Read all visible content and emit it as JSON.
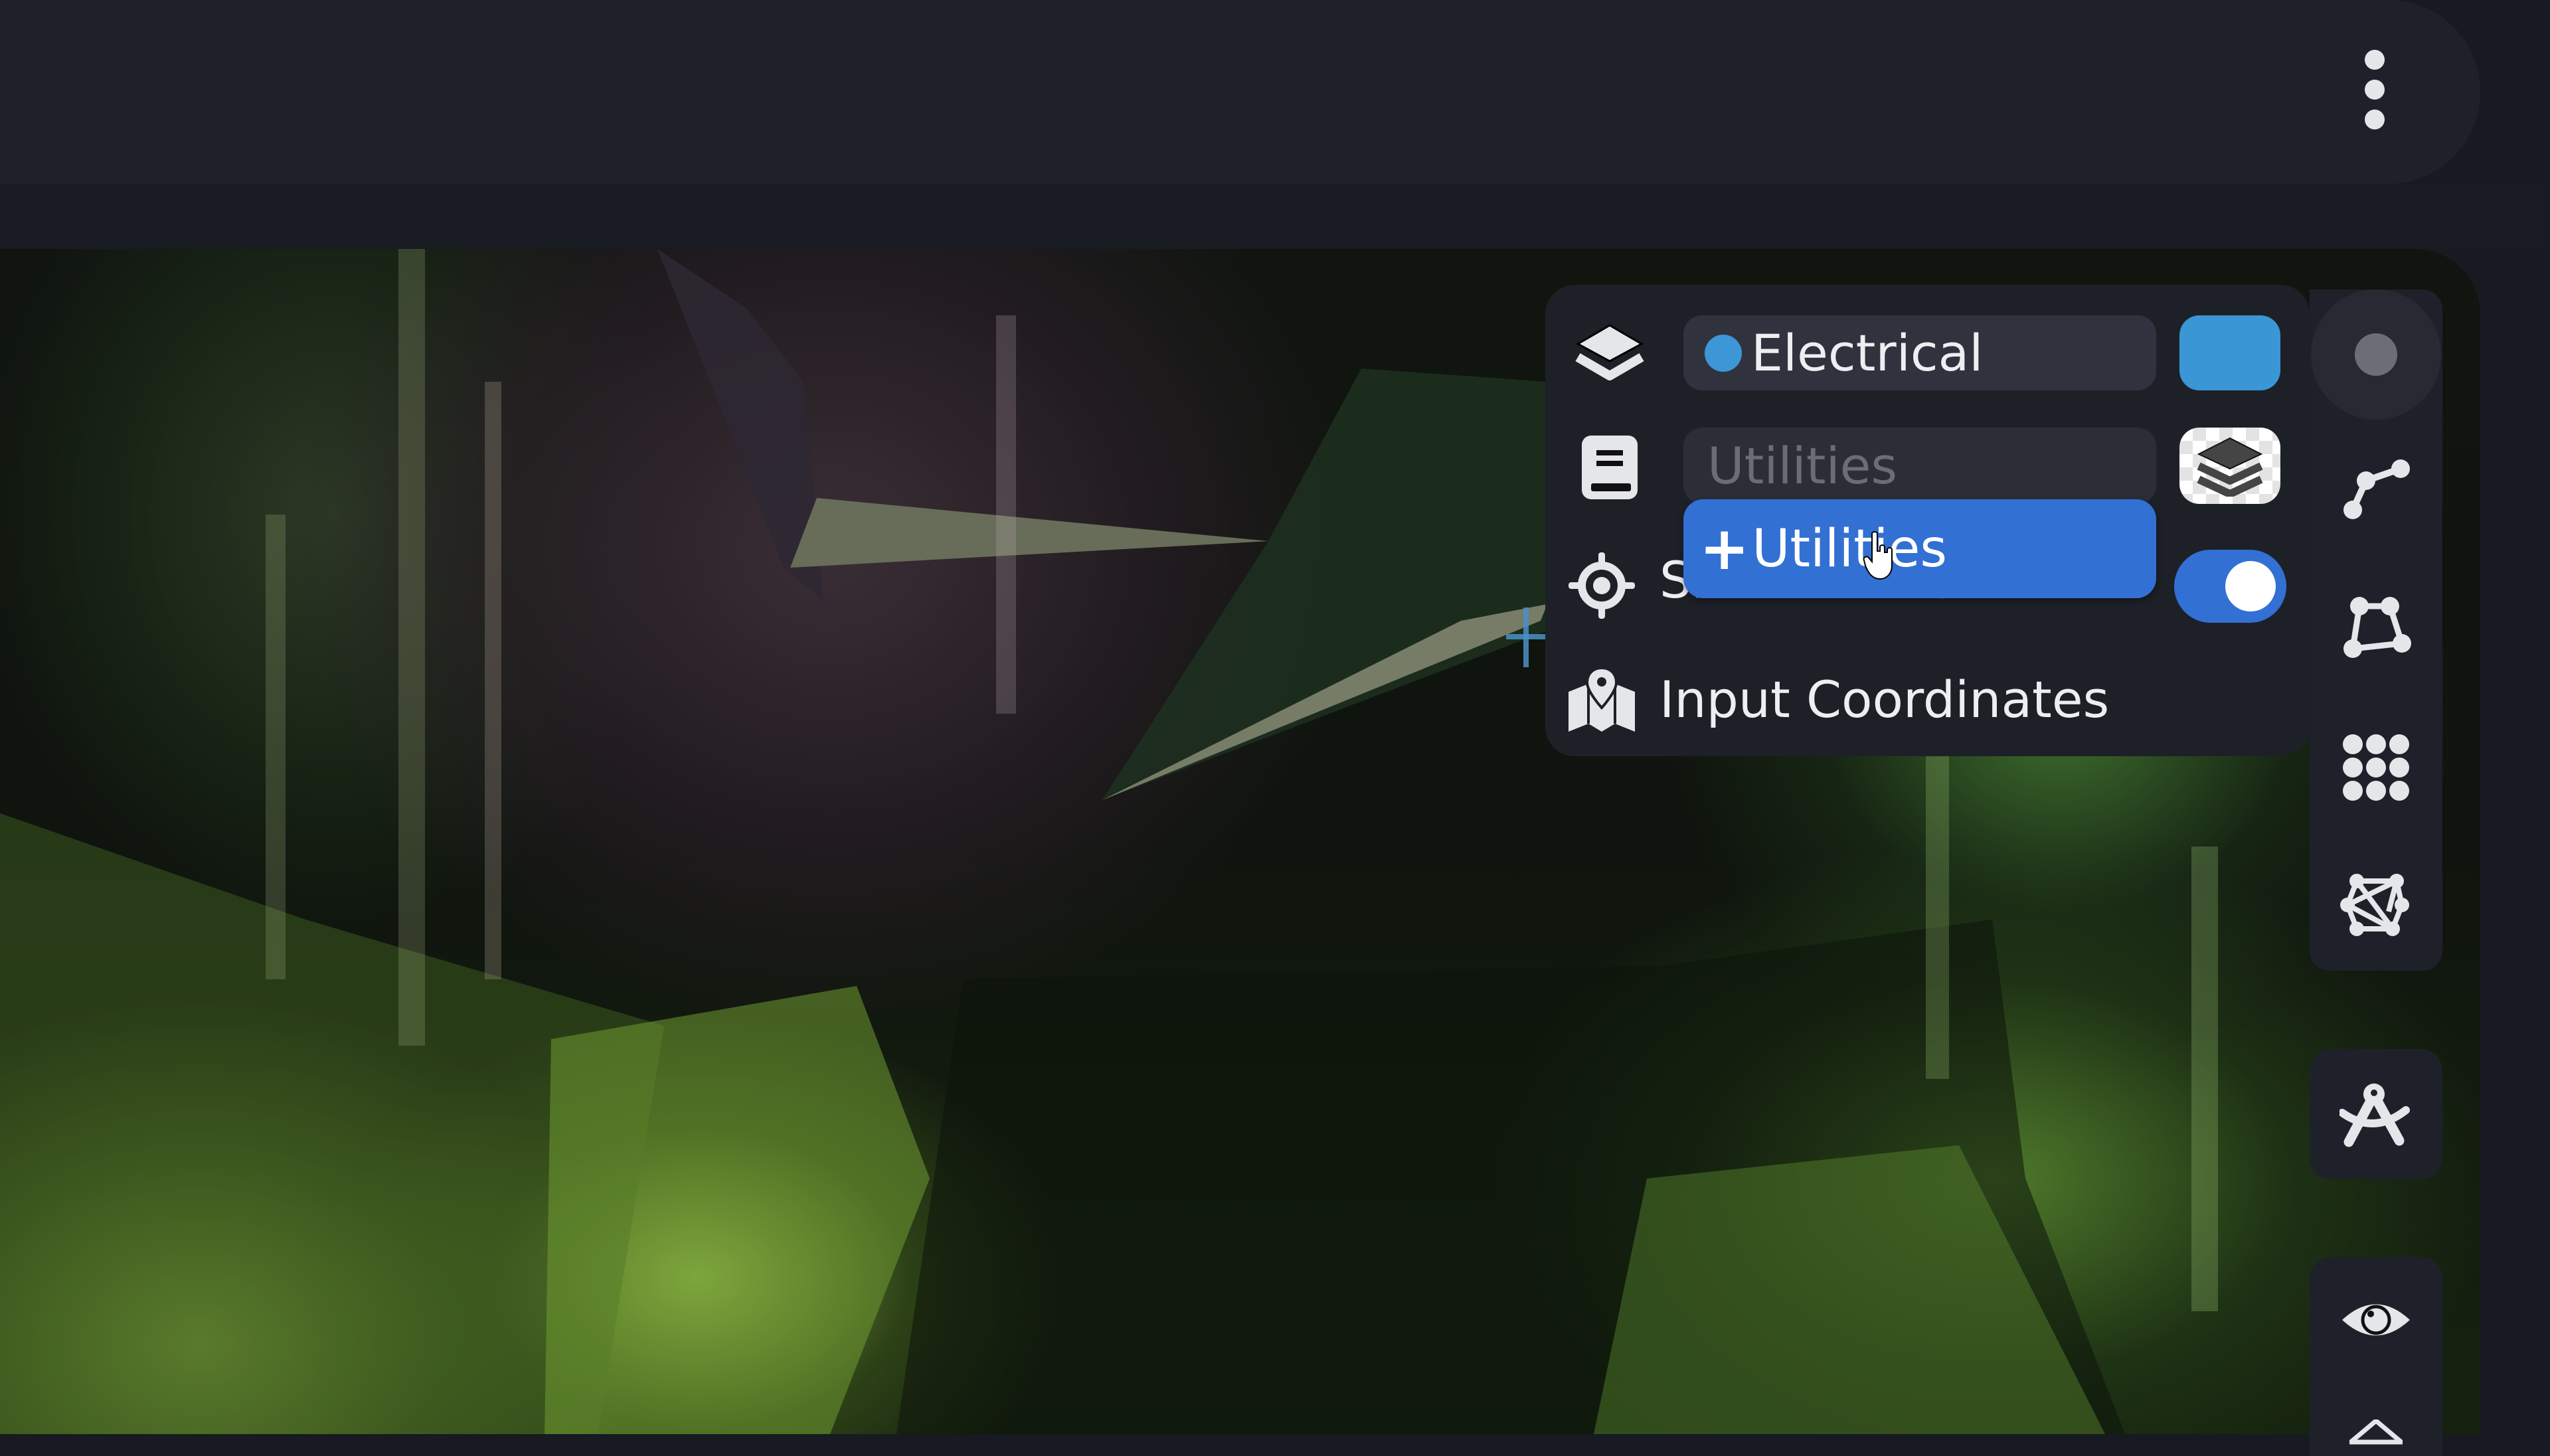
{
  "topbar": {
    "menu_icon": "kebab-vertical-icon"
  },
  "map": {
    "cursor": "crosshair-icon"
  },
  "layer_panel": {
    "layer_select": {
      "icon": "layers-icon",
      "selected": "Electrical",
      "dot_color": "#3d96d6"
    },
    "layer_color_swatch": "#3a96d4",
    "new_layer_input": {
      "icon": "book-icon",
      "placeholder": "Utilities",
      "value": ""
    },
    "layer_style_button_icon": "stacked-layers-icon",
    "suggestion": {
      "prefix": "+",
      "label": "Utilities"
    },
    "show_coordinates": {
      "icon": "target-icon",
      "label": "Show Coordinates",
      "enabled": true
    },
    "input_coordinates": {
      "icon": "map-pin-icon",
      "label": "Input Coordinates"
    },
    "accent_color": "#3270d4"
  },
  "toolbar": {
    "tools": [
      {
        "name": "point",
        "icon": "dot-icon",
        "active": true
      },
      {
        "name": "line",
        "icon": "polyline-icon"
      },
      {
        "name": "polygon",
        "icon": "polygon-icon"
      },
      {
        "name": "grid",
        "icon": "grid-dots-icon"
      },
      {
        "name": "mesh",
        "icon": "mesh-icon"
      }
    ],
    "measure_icon": "compass-drafting-icon",
    "visibility_icon": "eye-icon"
  }
}
